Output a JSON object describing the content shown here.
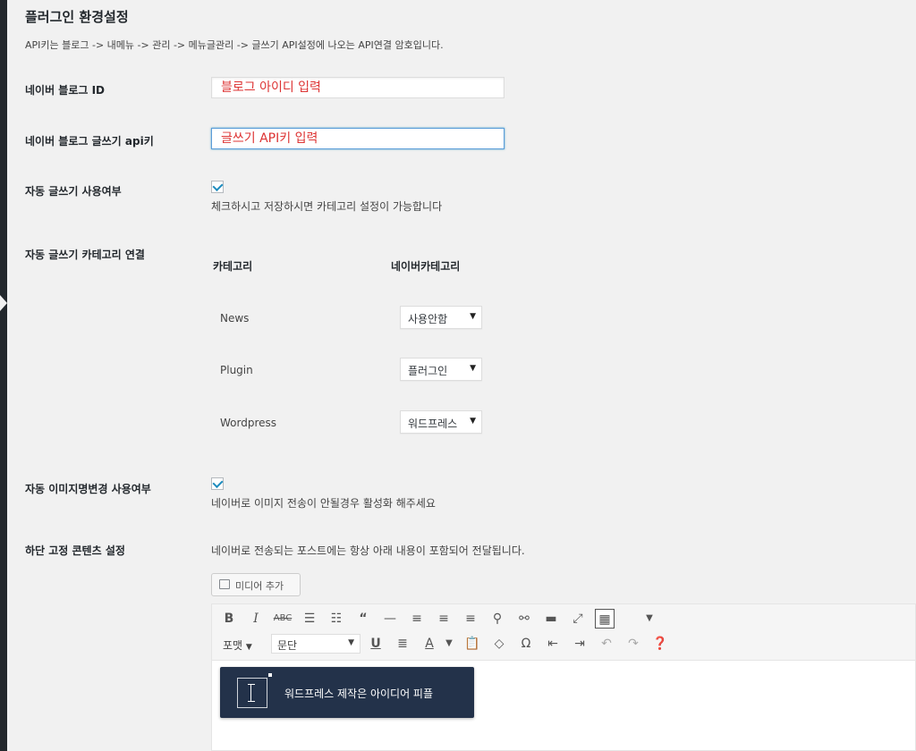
{
  "page": {
    "title": "플러그인 환경설정",
    "description": "API키는 블로그 -> 내메뉴 -> 관리 -> 메뉴글관리 -> 글쓰기 API설정에 나오는 API연결 암호입니다."
  },
  "fields": {
    "blog_id": {
      "label": "네이버 블로그 ID",
      "placeholder": "블로그 아이디 입력"
    },
    "api_key": {
      "label": "네이버 블로그 글쓰기 api키",
      "placeholder": "글쓰기 API키 입력"
    },
    "auto_post": {
      "label": "자동 글쓰기 사용여부",
      "checked": true,
      "hint": "체크하시고 저장하시면 카테고리 설정이 가능합니다"
    },
    "category_link": {
      "label": "자동 글쓰기 카테고리 연결",
      "col_category": "카테고리",
      "col_naver_category": "네이버카테고리",
      "rows": [
        {
          "name": "News",
          "selected": "사용안함"
        },
        {
          "name": "Plugin",
          "selected": "플러그인"
        },
        {
          "name": "Wordpress",
          "selected": "워드프레스"
        }
      ]
    },
    "auto_image_rename": {
      "label": "자동 이미지명변경 사용여부",
      "checked": true,
      "hint": "네이버로 이미지 전송이 안될경우 활성화 해주세요"
    },
    "footer_content": {
      "label": "하단 고정 콘텐츠 설정",
      "hint": "네이버로 전송되는 포스트에는 항상 아래 내용이 포함되어 전달됩니다.",
      "media_button": "미디어 추가"
    }
  },
  "editor": {
    "format_label": "포맷",
    "paragraph_select": "문단",
    "tooltip_text": "워드프레스 제작은 아이디어 피플"
  },
  "colors": {
    "placeholder": "#dd3333",
    "focus_border": "#5b9dd9",
    "checkmark": "#1e8cbe",
    "tooltip_bg": "#23324a",
    "admin_bar": "#23282d"
  }
}
